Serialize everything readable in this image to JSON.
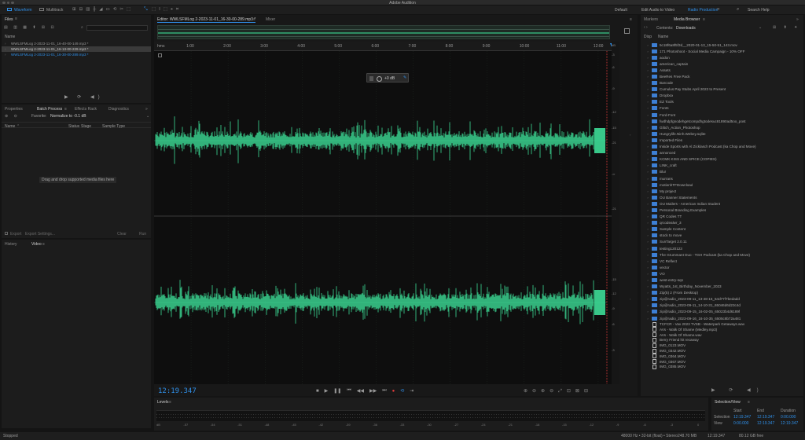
{
  "window": {
    "title": "Adobe Audition"
  },
  "toolbar": {
    "waveform": "Waveform",
    "multitrack": "Multitrack",
    "workspaces": [
      "Default",
      "Edit Audio to Video",
      "Radio Production"
    ],
    "search_placeholder": "Search Help"
  },
  "files_panel": {
    "title": "Files",
    "col_name": "Name",
    "files": [
      "WWLSFMLog 2-2023-11-01_16-40-00-149.mp3 *",
      "WWLSFMLog 2-2023-11-01_16-13-00-229.mp3 *",
      "WWLSFMLog 2-2023-11-01_16-30-00-289.mp3 *"
    ]
  },
  "mid_tabs": {
    "properties": "Properties",
    "batch": "Batch Process",
    "effects": "Effects Rack",
    "diagnostics": "Diagnostics",
    "favorite_label": "Favorite:",
    "favorite_value": "Normalize to -0.1 dB",
    "cols": [
      "Name",
      "Status",
      "Stage",
      "Sample Type"
    ],
    "drop_hint": "Drag and drop supported media files here",
    "export": "Export",
    "export_settings": "Export Settings...",
    "clear": "Clear",
    "run": "Run"
  },
  "lower_tabs": {
    "history": "History",
    "video": "Video"
  },
  "editor": {
    "tab": "Editor: WWLSFMLog 2-2023-11-01_16-30-00-289.mp3 *",
    "mixer": "Mixer",
    "time_unit": "hms",
    "ruler": [
      "1:00",
      "2:00",
      "3:00",
      "4:00",
      "5:00",
      "6:00",
      "7:00",
      "8:00",
      "9:00",
      "10:00",
      "11:00",
      "12:00"
    ],
    "hud_gain": "+0 dB",
    "db_ticks": [
      "dB",
      "-3",
      "-6",
      "-9",
      "-12",
      "-15",
      "-21",
      "-∞",
      "-21",
      "-15",
      "-12",
      "-9",
      "-6",
      "-3"
    ],
    "timecode": "12:19.347"
  },
  "media_browser": {
    "tabs": [
      "Markers",
      "Media Browser"
    ],
    "contents_label": "Contents:",
    "contents_value": "Downloads",
    "cols": [
      "Disp",
      "Name"
    ],
    "items": [
      {
        "type": "folder",
        "name": "5c18f6a8f5f3d__2020-01-13_15-50-51_143.mov"
      },
      {
        "type": "folder",
        "name": "171 Photoshoot - Social Media Campaign - 10% OFF"
      },
      {
        "type": "folder",
        "name": "aodon"
      },
      {
        "type": "folder",
        "name": "american_captain"
      },
      {
        "type": "folder",
        "name": "Assets"
      },
      {
        "type": "folder",
        "name": "BeeRes Free Pack"
      },
      {
        "type": "folder",
        "name": "Barcode"
      },
      {
        "type": "folder",
        "name": "Cumulus Pay Stubs April 2023 to Present"
      },
      {
        "type": "folder",
        "name": "Dropbox"
      },
      {
        "type": "folder",
        "name": "EZ Tools"
      },
      {
        "type": "folder",
        "name": "Fonts"
      },
      {
        "type": "folder",
        "name": "Ford-Font"
      },
      {
        "type": "folder",
        "name": "fwdhdpfgnodehgetcompdhgtodesuc81890ad5oo_post"
      },
      {
        "type": "folder",
        "name": "Glitch_Action_Photoshop"
      },
      {
        "type": "folder",
        "name": "Hungrylife.Ninh.Webey.sqlite"
      },
      {
        "type": "folder",
        "name": "Imported Files"
      },
      {
        "type": "folder",
        "name": "Inside Sports with Al Zicklasch Podcast (ka Chop and Move)"
      },
      {
        "type": "folder",
        "name": "annonced"
      },
      {
        "type": "folder",
        "name": "KCMK KISS AND SPICE (COPIES)"
      },
      {
        "type": "folder",
        "name": "LINK_craft"
      },
      {
        "type": "folder",
        "name": "Blur"
      },
      {
        "type": "folder",
        "name": "murrans"
      },
      {
        "type": "folder",
        "name": "motionhTFDownload"
      },
      {
        "type": "folder",
        "name": "My project"
      },
      {
        "type": "folder",
        "name": "OU Banner Statements"
      },
      {
        "type": "folder",
        "name": "OU Mailers - American Indian Student"
      },
      {
        "type": "folder",
        "name": "Personal Branding Examples"
      },
      {
        "type": "folder",
        "name": "QR Codes TT"
      },
      {
        "type": "folder",
        "name": "qrcodealwr_3"
      },
      {
        "type": "folder",
        "name": "Sample Content"
      },
      {
        "type": "folder",
        "name": "stock to move"
      },
      {
        "type": "folder",
        "name": "SunTarget 2.0.11"
      },
      {
        "type": "folder",
        "name": "testing120123"
      },
      {
        "type": "folder",
        "name": "The Grummant Duo - TGH Podcast (ka Chop and Move)"
      },
      {
        "type": "folder",
        "name": "VC Reflect"
      },
      {
        "type": "folder",
        "name": "vector"
      },
      {
        "type": "folder",
        "name": "VO"
      },
      {
        "type": "folder",
        "name": "west-entry-sqs"
      },
      {
        "type": "folder",
        "name": "Wyatts_1st_Birthday_November_2023"
      },
      {
        "type": "folder",
        "name": "Zip(5) 2 (From Desktop)"
      },
      {
        "type": "folder",
        "name": "zip@radio_2023-09-11_13-48-16_64d77f7bedadd"
      },
      {
        "type": "folder",
        "name": "zip@radio_2023-09-11_14-10-31_65046d6d23c4d"
      },
      {
        "type": "folder",
        "name": "zip@radio_2023-09-15_16-02-05_65023b4d6189f"
      },
      {
        "type": "folder",
        "name": "zip@radio_2023-09-16_16-10-35_6505c8b72a481"
      },
      {
        "type": "file",
        "name": "TCFCR - Vax 2023 TVSB - Waterpark Getaways.wav"
      },
      {
        "type": "file",
        "name": "AVs - Walk Of Shame (Medley.mp3)"
      },
      {
        "type": "file",
        "name": "AVs - Walk Of Shame.wav"
      },
      {
        "type": "file",
        "name": "Berry Friend hit recaway"
      },
      {
        "type": "file",
        "name": "IMG_0123.MOV"
      },
      {
        "type": "file",
        "name": "IMG_0342.MOV"
      },
      {
        "type": "file",
        "name": "IMG_0364.MOV"
      },
      {
        "type": "file",
        "name": "IMG_0367.MOV"
      },
      {
        "type": "file",
        "name": "IMG_0385.MOV"
      }
    ]
  },
  "levels": {
    "title": "Levels",
    "ticks": [
      "dB",
      "-57",
      "-54",
      "-51",
      "-48",
      "-45",
      "-42",
      "-39",
      "-36",
      "-33",
      "-30",
      "-27",
      "-24",
      "-21",
      "-18",
      "-15",
      "-12",
      "-9",
      "-6",
      "-3",
      "0"
    ]
  },
  "selection_view": {
    "title": "Selection/View",
    "cols": [
      "Start",
      "End",
      "Duration"
    ],
    "selection_label": "Selection",
    "view_label": "View",
    "selection": [
      "12:19.347",
      "12:19.347",
      "0:00.000"
    ],
    "view": [
      "0:00.000",
      "12:19.347",
      "12:19.347"
    ]
  },
  "status": {
    "state": "Stopped",
    "info": [
      "48000 Hz • 32-bit (float) • Stereo",
      "248.70 MB",
      "12:19.347",
      "80.12 GB free"
    ]
  },
  "colors": {
    "accent": "#2f8fe8",
    "wave": "#3ddc97",
    "bg": "#141414",
    "panel": "#1c1c1c",
    "stop": "#e23c3c"
  }
}
